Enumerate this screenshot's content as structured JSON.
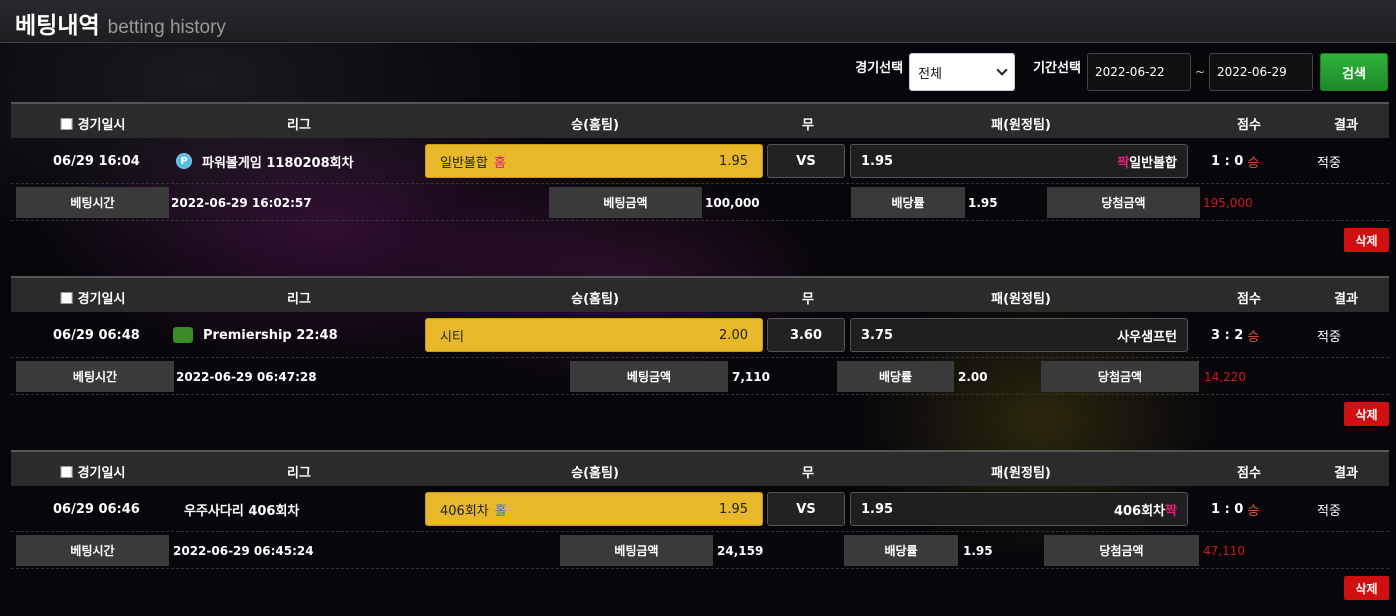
{
  "header": {
    "title": "베팅내역",
    "subtitle": "betting history"
  },
  "filter": {
    "game_label": "경기선택",
    "game_select": "전체",
    "period_label": "기간선택",
    "date_from": "2022-06-22",
    "date_sep": "~",
    "date_to": "2022-06-29",
    "search_label": "검색"
  },
  "columns": {
    "datetime": "경기일시",
    "league": "리그",
    "home": "승(홈팀)",
    "draw": "무",
    "away": "패(원정팀)",
    "score": "점수",
    "result": "결과"
  },
  "labels": {
    "bet_time": "베팅시간",
    "bet_amount": "베팅금액",
    "odds": "배당률",
    "win_amount": "당첨금액",
    "delete": "삭제"
  },
  "bets": [
    {
      "datetime": "06/29 16:04",
      "league": "파워볼게임 1180208회차",
      "league_icon": "powerball-icon",
      "home_name": "일반볼합",
      "home_tag": "홈",
      "home_odds": "1.95",
      "draw": "VS",
      "away_odds": "1.95",
      "away_tag": "짝",
      "away_name": "일반볼합",
      "score": "1 : 0",
      "score_tag": "승",
      "result": "적중",
      "bet_time": "2022-06-29 16:02:57",
      "bet_amount": "100,000",
      "odds": "1.95",
      "win_amount": "195,000"
    },
    {
      "datetime": "06/29 06:48",
      "league": "Premiership 22:48",
      "league_icon": "premiership-icon",
      "home_name": "시티",
      "home_tag": "",
      "home_odds": "2.00",
      "draw": "3.60",
      "away_odds": "3.75",
      "away_tag": "",
      "away_name": "사우샘프턴",
      "score": "3 : 2",
      "score_tag": "승",
      "result": "적중",
      "bet_time": "2022-06-29 06:47:28",
      "bet_amount": "7,110",
      "odds": "2.00",
      "win_amount": "14,220"
    },
    {
      "datetime": "06/29 06:46",
      "league": "우주사다리 406회차",
      "league_icon": "",
      "home_name": "406회차",
      "home_tag": "홀",
      "home_odds": "1.95",
      "draw": "VS",
      "away_odds": "1.95",
      "away_tag": "짝",
      "away_name": "406회차",
      "score": "1 : 0",
      "score_tag": "승",
      "result": "적중",
      "bet_time": "2022-06-29 06:45:24",
      "bet_amount": "24,159",
      "odds": "1.95",
      "win_amount": "47,110"
    }
  ]
}
